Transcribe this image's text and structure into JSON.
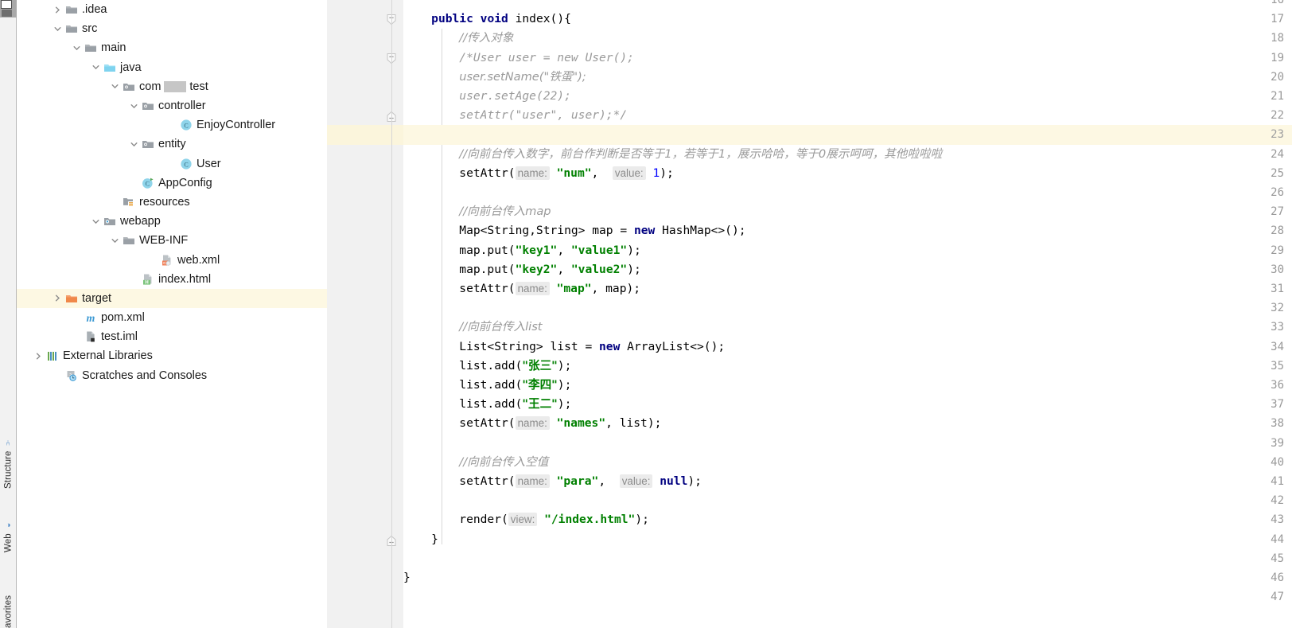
{
  "toolwindows": {
    "structure": "Structure",
    "web": "Web",
    "favorites": "avorites"
  },
  "project_tree": {
    "items": [
      {
        "label": ".idea",
        "indent": 1,
        "arrow": "chevron-right",
        "icon": "folder-gray",
        "selected": false
      },
      {
        "label": "src",
        "indent": 1,
        "arrow": "chevron-down",
        "icon": "folder-gray",
        "selected": false
      },
      {
        "label": "main",
        "indent": 2,
        "arrow": "chevron-down",
        "icon": "folder-gray",
        "selected": false
      },
      {
        "label": "java",
        "indent": 3,
        "arrow": "chevron-down",
        "icon": "folder-blue",
        "selected": false
      },
      {
        "label": "com",
        "indent": 4,
        "arrow": "chevron-down",
        "icon": "package-gray",
        "selected": false,
        "redacted": true,
        "label_tail": "test"
      },
      {
        "label": "controller",
        "indent": 5,
        "arrow": "chevron-down",
        "icon": "package-gray",
        "selected": false
      },
      {
        "label": "EnjoyController",
        "indent": 7,
        "arrow": "none",
        "icon": "class-java",
        "selected": false
      },
      {
        "label": "entity",
        "indent": 5,
        "arrow": "chevron-down",
        "icon": "package-gray",
        "selected": false
      },
      {
        "label": "User",
        "indent": 7,
        "arrow": "none",
        "icon": "class-java",
        "selected": false
      },
      {
        "label": "AppConfig",
        "indent": 5,
        "arrow": "none",
        "icon": "class-java-run",
        "selected": false
      },
      {
        "label": "resources",
        "indent": 4,
        "arrow": "none",
        "icon": "folder-resources",
        "selected": false
      },
      {
        "label": "webapp",
        "indent": 3,
        "arrow": "chevron-down",
        "icon": "folder-webapp",
        "selected": false
      },
      {
        "label": "WEB-INF",
        "indent": 4,
        "arrow": "chevron-down",
        "icon": "folder-gray",
        "selected": false
      },
      {
        "label": "web.xml",
        "indent": 6,
        "arrow": "none",
        "icon": "file-xml",
        "selected": false
      },
      {
        "label": "index.html",
        "indent": 5,
        "arrow": "none",
        "icon": "file-html",
        "selected": false
      },
      {
        "label": "target",
        "indent": 1,
        "arrow": "chevron-right",
        "icon": "folder-orange",
        "selected": true
      },
      {
        "label": "pom.xml",
        "indent": 2,
        "arrow": "none",
        "icon": "maven-m",
        "selected": false
      },
      {
        "label": "test.iml",
        "indent": 2,
        "arrow": "none",
        "icon": "file-iml",
        "selected": false
      },
      {
        "label": "External Libraries",
        "indent": 0,
        "arrow": "chevron-right",
        "icon": "libraries",
        "selected": false
      },
      {
        "label": "Scratches and Consoles",
        "indent": 1,
        "arrow": "none",
        "icon": "scratches",
        "selected": false
      }
    ]
  },
  "editor": {
    "first_visible_line": 16,
    "current_line": 23,
    "lines": [
      {
        "n": 16,
        "clipped": true,
        "fold": "none",
        "tokens": []
      },
      {
        "n": 17,
        "fold": "open-top",
        "tokens": [
          {
            "t": "    ",
            "c": "plain"
          },
          {
            "t": "public",
            "c": "kw"
          },
          {
            "t": " ",
            "c": "plain"
          },
          {
            "t": "void",
            "c": "kw"
          },
          {
            "t": " index(){",
            "c": "plain"
          }
        ]
      },
      {
        "n": 18,
        "fold": "none",
        "tokens": [
          {
            "t": "        ",
            "c": "plain"
          },
          {
            "t": "//传入对象",
            "c": "cmt"
          }
        ]
      },
      {
        "n": 19,
        "fold": "open-top",
        "tokens": [
          {
            "t": "        ",
            "c": "plain"
          },
          {
            "t": "/*User user = new User();",
            "c": "cmt"
          }
        ]
      },
      {
        "n": 20,
        "fold": "none",
        "tokens": [
          {
            "t": "        ",
            "c": "plain"
          },
          {
            "t": "user.setName(\"铁蛋\");",
            "c": "cmt"
          }
        ]
      },
      {
        "n": 21,
        "fold": "none",
        "tokens": [
          {
            "t": "        ",
            "c": "plain"
          },
          {
            "t": "user.setAge(22);",
            "c": "cmt"
          }
        ]
      },
      {
        "n": 22,
        "fold": "close-bottom",
        "tokens": [
          {
            "t": "        ",
            "c": "plain"
          },
          {
            "t": "setAttr(\"user\", user);*/",
            "c": "cmt"
          }
        ]
      },
      {
        "n": 23,
        "fold": "none",
        "current": true,
        "tokens": []
      },
      {
        "n": 24,
        "fold": "none",
        "tokens": [
          {
            "t": "        ",
            "c": "plain"
          },
          {
            "t": "//向前台传入数字，前台作判断是否等于1，若等于1，展示哈哈，等于0展示呵呵，其他啦啦啦",
            "c": "cmt"
          }
        ]
      },
      {
        "n": 25,
        "fold": "none",
        "tokens": [
          {
            "t": "        setAttr(",
            "c": "plain"
          },
          {
            "t": "name:",
            "c": "hint"
          },
          {
            "t": " ",
            "c": "plain"
          },
          {
            "t": "\"num\"",
            "c": "str"
          },
          {
            "t": ",  ",
            "c": "plain"
          },
          {
            "t": "value:",
            "c": "hint"
          },
          {
            "t": " ",
            "c": "plain"
          },
          {
            "t": "1",
            "c": "num"
          },
          {
            "t": ");",
            "c": "plain"
          }
        ]
      },
      {
        "n": 26,
        "fold": "none",
        "tokens": []
      },
      {
        "n": 27,
        "fold": "none",
        "tokens": [
          {
            "t": "        ",
            "c": "plain"
          },
          {
            "t": "//向前台传入map",
            "c": "cmt"
          }
        ]
      },
      {
        "n": 28,
        "fold": "none",
        "tokens": [
          {
            "t": "        Map<String,String> map = ",
            "c": "plain"
          },
          {
            "t": "new",
            "c": "kw"
          },
          {
            "t": " HashMap<>();",
            "c": "plain"
          }
        ]
      },
      {
        "n": 29,
        "fold": "none",
        "tokens": [
          {
            "t": "        map.put(",
            "c": "plain"
          },
          {
            "t": "\"key1\"",
            "c": "str"
          },
          {
            "t": ", ",
            "c": "plain"
          },
          {
            "t": "\"value1\"",
            "c": "str"
          },
          {
            "t": ");",
            "c": "plain"
          }
        ]
      },
      {
        "n": 30,
        "fold": "none",
        "tokens": [
          {
            "t": "        map.put(",
            "c": "plain"
          },
          {
            "t": "\"key2\"",
            "c": "str"
          },
          {
            "t": ", ",
            "c": "plain"
          },
          {
            "t": "\"value2\"",
            "c": "str"
          },
          {
            "t": ");",
            "c": "plain"
          }
        ]
      },
      {
        "n": 31,
        "fold": "none",
        "tokens": [
          {
            "t": "        setAttr(",
            "c": "plain"
          },
          {
            "t": "name:",
            "c": "hint"
          },
          {
            "t": " ",
            "c": "plain"
          },
          {
            "t": "\"map\"",
            "c": "str"
          },
          {
            "t": ", map);",
            "c": "plain"
          }
        ]
      },
      {
        "n": 32,
        "fold": "none",
        "tokens": []
      },
      {
        "n": 33,
        "fold": "none",
        "tokens": [
          {
            "t": "        ",
            "c": "plain"
          },
          {
            "t": "//向前台传入list",
            "c": "cmt"
          }
        ]
      },
      {
        "n": 34,
        "fold": "none",
        "tokens": [
          {
            "t": "        List<String> list = ",
            "c": "plain"
          },
          {
            "t": "new",
            "c": "kw"
          },
          {
            "t": " ArrayList<>();",
            "c": "plain"
          }
        ]
      },
      {
        "n": 35,
        "fold": "none",
        "tokens": [
          {
            "t": "        list.add(",
            "c": "plain"
          },
          {
            "t": "\"张三\"",
            "c": "str"
          },
          {
            "t": ");",
            "c": "plain"
          }
        ]
      },
      {
        "n": 36,
        "fold": "none",
        "tokens": [
          {
            "t": "        list.add(",
            "c": "plain"
          },
          {
            "t": "\"李四\"",
            "c": "str"
          },
          {
            "t": ");",
            "c": "plain"
          }
        ]
      },
      {
        "n": 37,
        "fold": "none",
        "tokens": [
          {
            "t": "        list.add(",
            "c": "plain"
          },
          {
            "t": "\"王二\"",
            "c": "str"
          },
          {
            "t": ");",
            "c": "plain"
          }
        ]
      },
      {
        "n": 38,
        "fold": "none",
        "tokens": [
          {
            "t": "        setAttr(",
            "c": "plain"
          },
          {
            "t": "name:",
            "c": "hint"
          },
          {
            "t": " ",
            "c": "plain"
          },
          {
            "t": "\"names\"",
            "c": "str"
          },
          {
            "t": ", list);",
            "c": "plain"
          }
        ]
      },
      {
        "n": 39,
        "fold": "none",
        "tokens": []
      },
      {
        "n": 40,
        "fold": "none",
        "tokens": [
          {
            "t": "        ",
            "c": "plain"
          },
          {
            "t": "//向前台传入空值",
            "c": "cmt"
          }
        ]
      },
      {
        "n": 41,
        "fold": "none",
        "tokens": [
          {
            "t": "        setAttr(",
            "c": "plain"
          },
          {
            "t": "name:",
            "c": "hint"
          },
          {
            "t": " ",
            "c": "plain"
          },
          {
            "t": "\"para\"",
            "c": "str"
          },
          {
            "t": ",  ",
            "c": "plain"
          },
          {
            "t": "value:",
            "c": "hint"
          },
          {
            "t": " ",
            "c": "plain"
          },
          {
            "t": "null",
            "c": "kw"
          },
          {
            "t": ");",
            "c": "plain"
          }
        ]
      },
      {
        "n": 42,
        "fold": "none",
        "tokens": []
      },
      {
        "n": 43,
        "fold": "none",
        "tokens": [
          {
            "t": "        render(",
            "c": "plain"
          },
          {
            "t": "view:",
            "c": "hint"
          },
          {
            "t": " ",
            "c": "plain"
          },
          {
            "t": "\"/index.html\"",
            "c": "str"
          },
          {
            "t": ");",
            "c": "plain"
          }
        ]
      },
      {
        "n": 44,
        "fold": "close-bottom",
        "tokens": [
          {
            "t": "    }",
            "c": "plain"
          }
        ]
      },
      {
        "n": 45,
        "fold": "none",
        "tokens": []
      },
      {
        "n": 46,
        "fold": "none",
        "tokens": [
          {
            "t": "}",
            "c": "plain"
          }
        ]
      },
      {
        "n": 47,
        "fold": "none",
        "tokens": []
      }
    ]
  },
  "colors": {
    "current_line_highlight": "#fdf8e3",
    "gutter_background": "#f1f1f1",
    "keyword": "#000080",
    "string": "#008000",
    "comment": "#9a9a9a",
    "number": "#0000ff",
    "hint_background": "#ebebeb"
  }
}
